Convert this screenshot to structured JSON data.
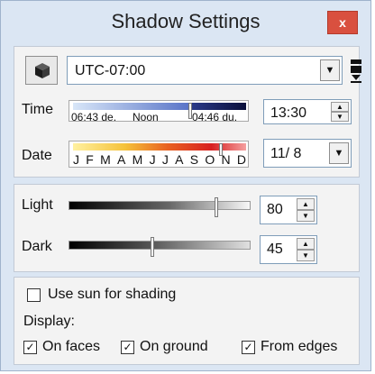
{
  "window": {
    "title": "Shadow Settings",
    "close_label": "x"
  },
  "timezone": {
    "value": "UTC-07:00"
  },
  "time": {
    "label": "Time",
    "sunrise": "06:43 de.",
    "noon": "Noon",
    "sunset": "04:46 du.",
    "value": "13:30"
  },
  "date": {
    "label": "Date",
    "months": [
      "J",
      "F",
      "M",
      "A",
      "M",
      "J",
      "J",
      "A",
      "S",
      "O",
      "N",
      "D"
    ],
    "value": "11/ 8"
  },
  "light": {
    "label": "Light",
    "value": "80",
    "level": 0.8
  },
  "dark": {
    "label": "Dark",
    "value": "45",
    "level": 0.45
  },
  "options": {
    "use_sun_label": "Use sun for shading",
    "use_sun_checked": false,
    "display_label": "Display:",
    "on_faces_label": "On faces",
    "on_ground_label": "On ground",
    "from_edges_label": "From edges",
    "check_glyph": "✓"
  }
}
